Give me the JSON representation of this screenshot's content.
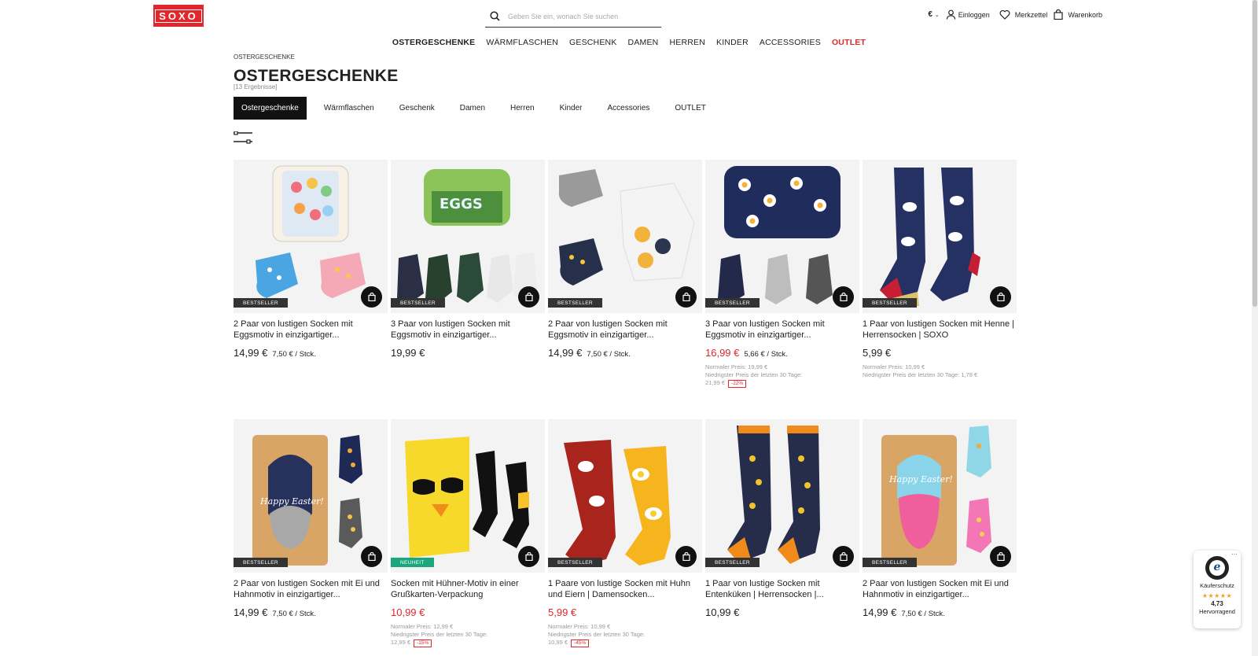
{
  "header": {
    "logo": "SOXO",
    "search_placeholder": "Geben Sie ein, wonach Sie suchen",
    "currency": "€",
    "login": "Einloggen",
    "wishlist": "Merkzettel",
    "cart": "Warenkorb"
  },
  "nav": [
    "OSTERGESCHENKE",
    "WÄRMFLASCHEN",
    "GESCHENK",
    "DAMEN",
    "HERREN",
    "KINDER",
    "ACCESSORIES",
    "OUTLET"
  ],
  "breadcrumb": "OSTERGESCHENKE",
  "page_title": "OSTERGESCHENKE",
  "result_count": "[13 Ergebnisse]",
  "tabs": [
    "Ostergeschenke",
    "Wärmflaschen",
    "Geschenk",
    "Damen",
    "Herren",
    "Kinder",
    "Accessories",
    "OUTLET"
  ],
  "products": [
    {
      "name": "2 Paar von lustigen Socken mit Eggsmotiv in einzigartiger...",
      "badge": "BESTSELLER",
      "price": "14,99 €",
      "unit": "7,50 € / Stck."
    },
    {
      "name": "3 Paar von lustigen Socken mit Eggsmotiv in einzigartiger...",
      "badge": "BESTSELLER",
      "price": "19,99 €",
      "unit": ""
    },
    {
      "name": "2 Paar von lustigen Socken mit Eggsmotiv in einzigartiger...",
      "badge": "BESTSELLER",
      "price": "14,99 €",
      "unit": "7,50 € / Stck."
    },
    {
      "name": "3 Paar von lustigen Socken mit Eggsmotiv in einzigartiger...",
      "badge": "BESTSELLER",
      "price": "16,99 €",
      "unit": "5,66 € / Stck.",
      "sale": true,
      "normal": "Normaler Preis: 19,99 €",
      "lowest": "Niedrigster Preis der letzten 30 Tage:",
      "lowest_value": "21,99 €",
      "discount": "-22%"
    },
    {
      "name": "1 Paar von lustigen Socken mit Henne | Herrensocken | SOXO",
      "badge": "BESTSELLER",
      "price": "5,99 €",
      "unit": "",
      "normal": "Normaler Preis: 10,99 €",
      "lowest": "Niedrigster Preis der letzten 30 Tage: 1,78 €"
    },
    {
      "name": "2 Paar von lustigen Socken mit Ei und Hahnmotiv in einzigartiger...",
      "badge": "BESTSELLER",
      "price": "14,99 €",
      "unit": "7,50 € / Stck."
    },
    {
      "name": "Socken mit Hühner-Motiv in einer Grußkarten-Verpackung",
      "badge": "NEUHEIT",
      "price": "10,99 €",
      "unit": "",
      "sale": true,
      "normal": "Normaler Preis: 12,99 €",
      "lowest": "Niedrigster Preis der letzten 30 Tage:",
      "lowest_value": "12,99 €",
      "discount": "-15%"
    },
    {
      "name": "1 Paare von lustige Socken mit Huhn und Eiern | Damensocken...",
      "badge": "BESTSELLER",
      "price": "5,99 €",
      "unit": "",
      "sale": true,
      "normal": "Normaler Preis: 10,99 €",
      "lowest": "Niedrigster Preis der letzten 30 Tage:",
      "lowest_value": "10,99 €",
      "discount": "-45%"
    },
    {
      "name": "1 Paar von lustige Socken mit Entenküken | Herrensocken |...",
      "badge": "BESTSELLER",
      "price": "10,99 €",
      "unit": ""
    },
    {
      "name": "2 Paar von lustigen Socken mit Ei und Hahnmotiv in einzigartiger...",
      "badge": "BESTSELLER",
      "price": "14,99 €",
      "unit": "7,50 € / Stck."
    }
  ],
  "trust": {
    "label": "Käuferschutz",
    "stars": "★★★★★",
    "rating": "4,73",
    "verdict": "Hervorragend"
  },
  "colors": {
    "accent": "#e2262e",
    "new_badge": "#1aa77e",
    "active_tab": "#111111"
  }
}
